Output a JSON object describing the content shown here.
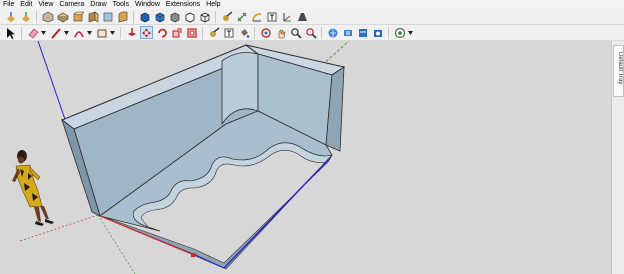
{
  "menu": [
    "File",
    "Edit",
    "View",
    "Camera",
    "Draw",
    "Tools",
    "Window",
    "Extensions",
    "Help"
  ],
  "toolbar_top": [
    {
      "icon": "get-models-icon"
    },
    {
      "icon": "share-model-icon"
    },
    {
      "icon": "iso-view-icon"
    },
    {
      "icon": "top-view-icon"
    },
    {
      "icon": "front-view-icon"
    },
    {
      "icon": "right-view-icon"
    },
    {
      "icon": "back-view-icon"
    },
    {
      "icon": "left-view-icon"
    },
    {
      "icon": "shaded-style-icon"
    },
    {
      "icon": "textured-style-icon"
    },
    {
      "icon": "monochrome-style-icon"
    },
    {
      "icon": "hidden-line-style-icon"
    },
    {
      "icon": "wireframe-style-icon"
    },
    {
      "icon": "tape-measure-icon"
    },
    {
      "icon": "dimension-icon"
    },
    {
      "icon": "protractor-icon"
    },
    {
      "icon": "text-tool-icon"
    },
    {
      "icon": "axes-tool-icon"
    },
    {
      "icon": "3d-text-icon"
    }
  ],
  "toolbar_main": [
    {
      "icon": "select-arrow-icon"
    },
    {
      "icon": "eraser-icon"
    },
    {
      "icon": "line-tool-icon"
    },
    {
      "icon": "arc-tool-icon"
    },
    {
      "icon": "rectangle-tool-icon"
    },
    {
      "icon": "push-pull-icon"
    },
    {
      "icon": "move-tool-icon",
      "active": true
    },
    {
      "icon": "rotate-tool-icon"
    },
    {
      "icon": "scale-tool-icon"
    },
    {
      "icon": "offset-tool-icon"
    },
    {
      "icon": "tape-measure-icon"
    },
    {
      "icon": "text-tool-icon"
    },
    {
      "icon": "paint-bucket-icon"
    },
    {
      "icon": "orbit-icon"
    },
    {
      "icon": "pan-icon"
    },
    {
      "icon": "zoom-icon"
    },
    {
      "icon": "zoom-extents-icon"
    },
    {
      "icon": "warehouse-icon"
    },
    {
      "icon": "extension-warehouse-icon"
    },
    {
      "icon": "layout-icon"
    },
    {
      "icon": "extension-manager-icon"
    },
    {
      "icon": "geo-location-icon"
    }
  ],
  "tray": {
    "label": "Default Tray"
  },
  "colors": {
    "viewport_bg": "#d7d7d7",
    "model_face": "#a9bfcf",
    "model_floor": "#a2b8c8",
    "model_top": "#c5d5e0",
    "axis_red": "#d22727",
    "axis_green": "#2c9a2c",
    "axis_blue": "#2323c8",
    "active_tool_bg": "#cfe3f8"
  }
}
